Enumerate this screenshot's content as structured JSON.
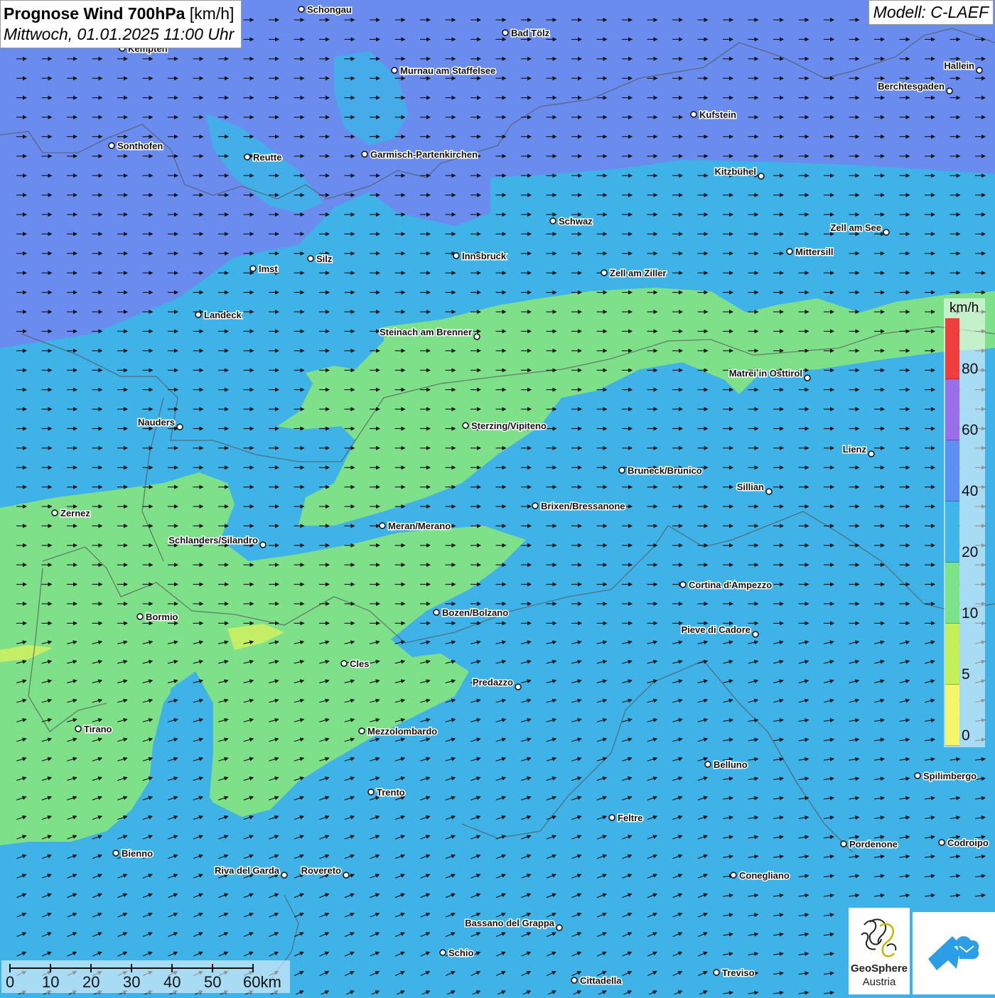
{
  "header": {
    "title_bold": "Prognose Wind 700hPa",
    "title_unit": "[km/h]",
    "date": "Mittwoch, 01.01.2025 11:00 Uhr",
    "model": "Modell: C-LAEF"
  },
  "legend": {
    "unit": "km/h",
    "labels": [
      "80",
      "60",
      "40",
      "20",
      "10",
      "5",
      "0"
    ],
    "colors": [
      "#f03e3e",
      "#9a6ee8",
      "#5b8ff0",
      "#3fb6ea",
      "#7be48a",
      "#c4f058",
      "#f6f66a"
    ]
  },
  "scalebar": {
    "labels": [
      "0",
      "10",
      "20",
      "30",
      "40",
      "50",
      "60km"
    ]
  },
  "logo": {
    "name_line1": "GeoSphere",
    "name_line2": "Austria"
  },
  "cities": [
    {
      "name": "Schongau"
    },
    {
      "name": "Bad Tölz"
    },
    {
      "name": "Kempten"
    },
    {
      "name": "Murnau am Staffelsee"
    },
    {
      "name": "Hallein"
    },
    {
      "name": "Berchtesgaden"
    },
    {
      "name": "Kufstein"
    },
    {
      "name": "Sonthofen"
    },
    {
      "name": "Reutte"
    },
    {
      "name": "Garmisch-Partenkirchen"
    },
    {
      "name": "Kitzbühel"
    },
    {
      "name": "Schwaz"
    },
    {
      "name": "Zell am See"
    },
    {
      "name": "Mittersill"
    },
    {
      "name": "Innsbruck"
    },
    {
      "name": "Silz"
    },
    {
      "name": "Imst"
    },
    {
      "name": "Zell am Ziller"
    },
    {
      "name": "Landeck"
    },
    {
      "name": "Steinach am Brenner"
    },
    {
      "name": "Matrei in Osttirol"
    },
    {
      "name": "Nauders"
    },
    {
      "name": "Sterzing/Vipiteno"
    },
    {
      "name": "Lienz"
    },
    {
      "name": "Bruneck/Brunico"
    },
    {
      "name": "Sillian"
    },
    {
      "name": "Brixen/Bressanone"
    },
    {
      "name": "Zernez"
    },
    {
      "name": "Meran/Merano"
    },
    {
      "name": "Schlanders/Silandro"
    },
    {
      "name": "Cortina d'Ampezzo"
    },
    {
      "name": "Bozen/Bolzano"
    },
    {
      "name": "Bormio"
    },
    {
      "name": "Pieve di Cadore"
    },
    {
      "name": "Cles"
    },
    {
      "name": "Predazzo"
    },
    {
      "name": "Tirano"
    },
    {
      "name": "Mezzolombardo"
    },
    {
      "name": "Belluno"
    },
    {
      "name": "Spilimbergo"
    },
    {
      "name": "Trento"
    },
    {
      "name": "Feltre"
    },
    {
      "name": "Pordenone"
    },
    {
      "name": "Codroipo"
    },
    {
      "name": "Bienno"
    },
    {
      "name": "Riva del Garda"
    },
    {
      "name": "Rovereto"
    },
    {
      "name": "Conegliano"
    },
    {
      "name": "Bassano del Grappa"
    },
    {
      "name": "Schio"
    },
    {
      "name": "Treviso"
    },
    {
      "name": "Cittadella"
    }
  ]
}
